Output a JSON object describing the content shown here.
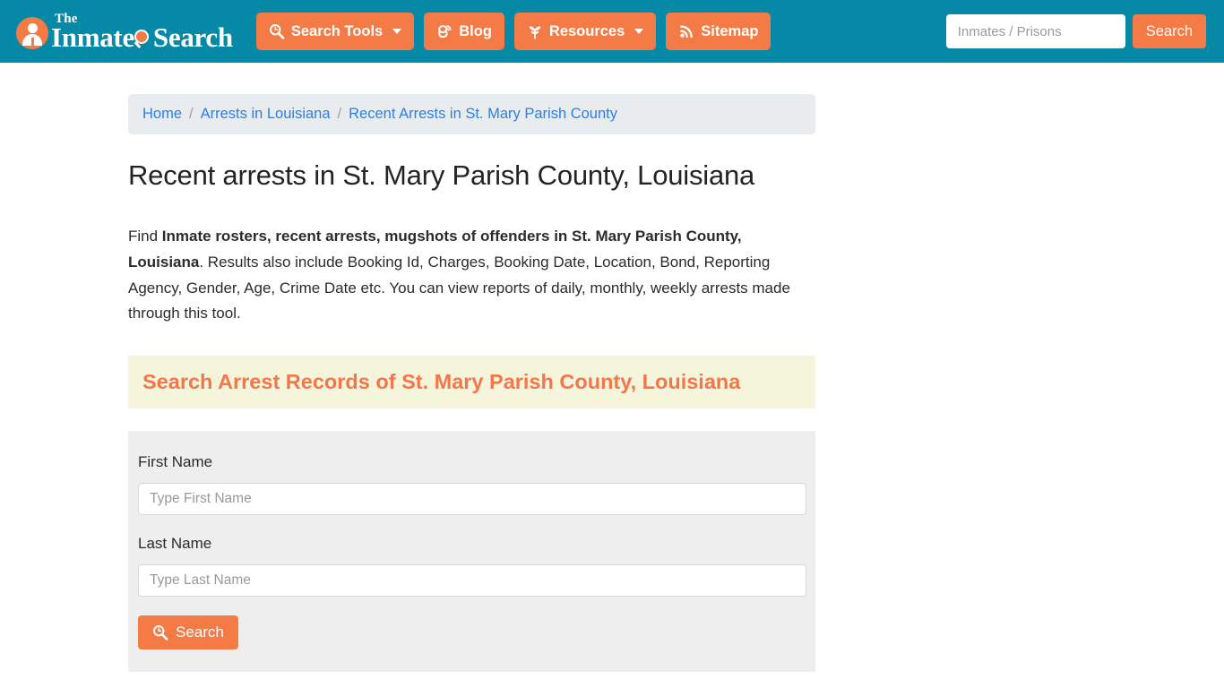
{
  "theme": {
    "header_bg": "#0589a6",
    "accent": "#f47b45",
    "link": "#2a7fe8",
    "banner_bg": "#f5f5dc",
    "banner_text": "#f4764a",
    "form_bg": "#eeeeee",
    "breadcrumb_bg": "#e9ecef"
  },
  "header": {
    "logo": {
      "the": "The",
      "word1": "Inmate",
      "word2": "Search",
      "badge_icon": "person-in-circle-icon",
      "mag_icon": "magnifier-icon"
    },
    "nav": [
      {
        "label": "Search Tools",
        "icon": "search-tools-icon",
        "caret": true
      },
      {
        "label": "Blog",
        "icon": "blogger-icon",
        "caret": false
      },
      {
        "label": "Resources",
        "icon": "leaf-icon",
        "caret": true
      },
      {
        "label": "Sitemap",
        "icon": "rss-icon",
        "caret": false
      }
    ],
    "search": {
      "placeholder": "Inmates / Prisons",
      "value": "",
      "button_label": "Search"
    }
  },
  "breadcrumb": {
    "items": [
      {
        "label": "Home",
        "current": false
      },
      {
        "label": "Arrests in Louisiana",
        "current": false
      },
      {
        "label": "Recent Arrests in St. Mary Parish County",
        "current": true
      }
    ],
    "separator": "/"
  },
  "main": {
    "title": "Recent arrests in St. Mary Parish County, Louisiana",
    "intro": {
      "lead": "Find ",
      "bold": "Inmate rosters, recent arrests, mugshots of offenders in St. Mary Parish County, Louisiana",
      "rest": ". Results also include Booking Id, Charges, Booking Date, Location, Bond, Reporting Agency, Gender, Age, Crime Date etc. You can view reports of daily, monthly, weekly arrests made through this tool."
    },
    "banner_title": "Search Arrest Records of St. Mary Parish County, Louisiana",
    "form": {
      "fields": [
        {
          "label": "First Name",
          "placeholder": "Type First Name",
          "value": ""
        },
        {
          "label": "Last Name",
          "placeholder": "Type Last Name",
          "value": ""
        }
      ],
      "submit_label": "Search",
      "submit_icon": "magnifier-icon"
    }
  }
}
